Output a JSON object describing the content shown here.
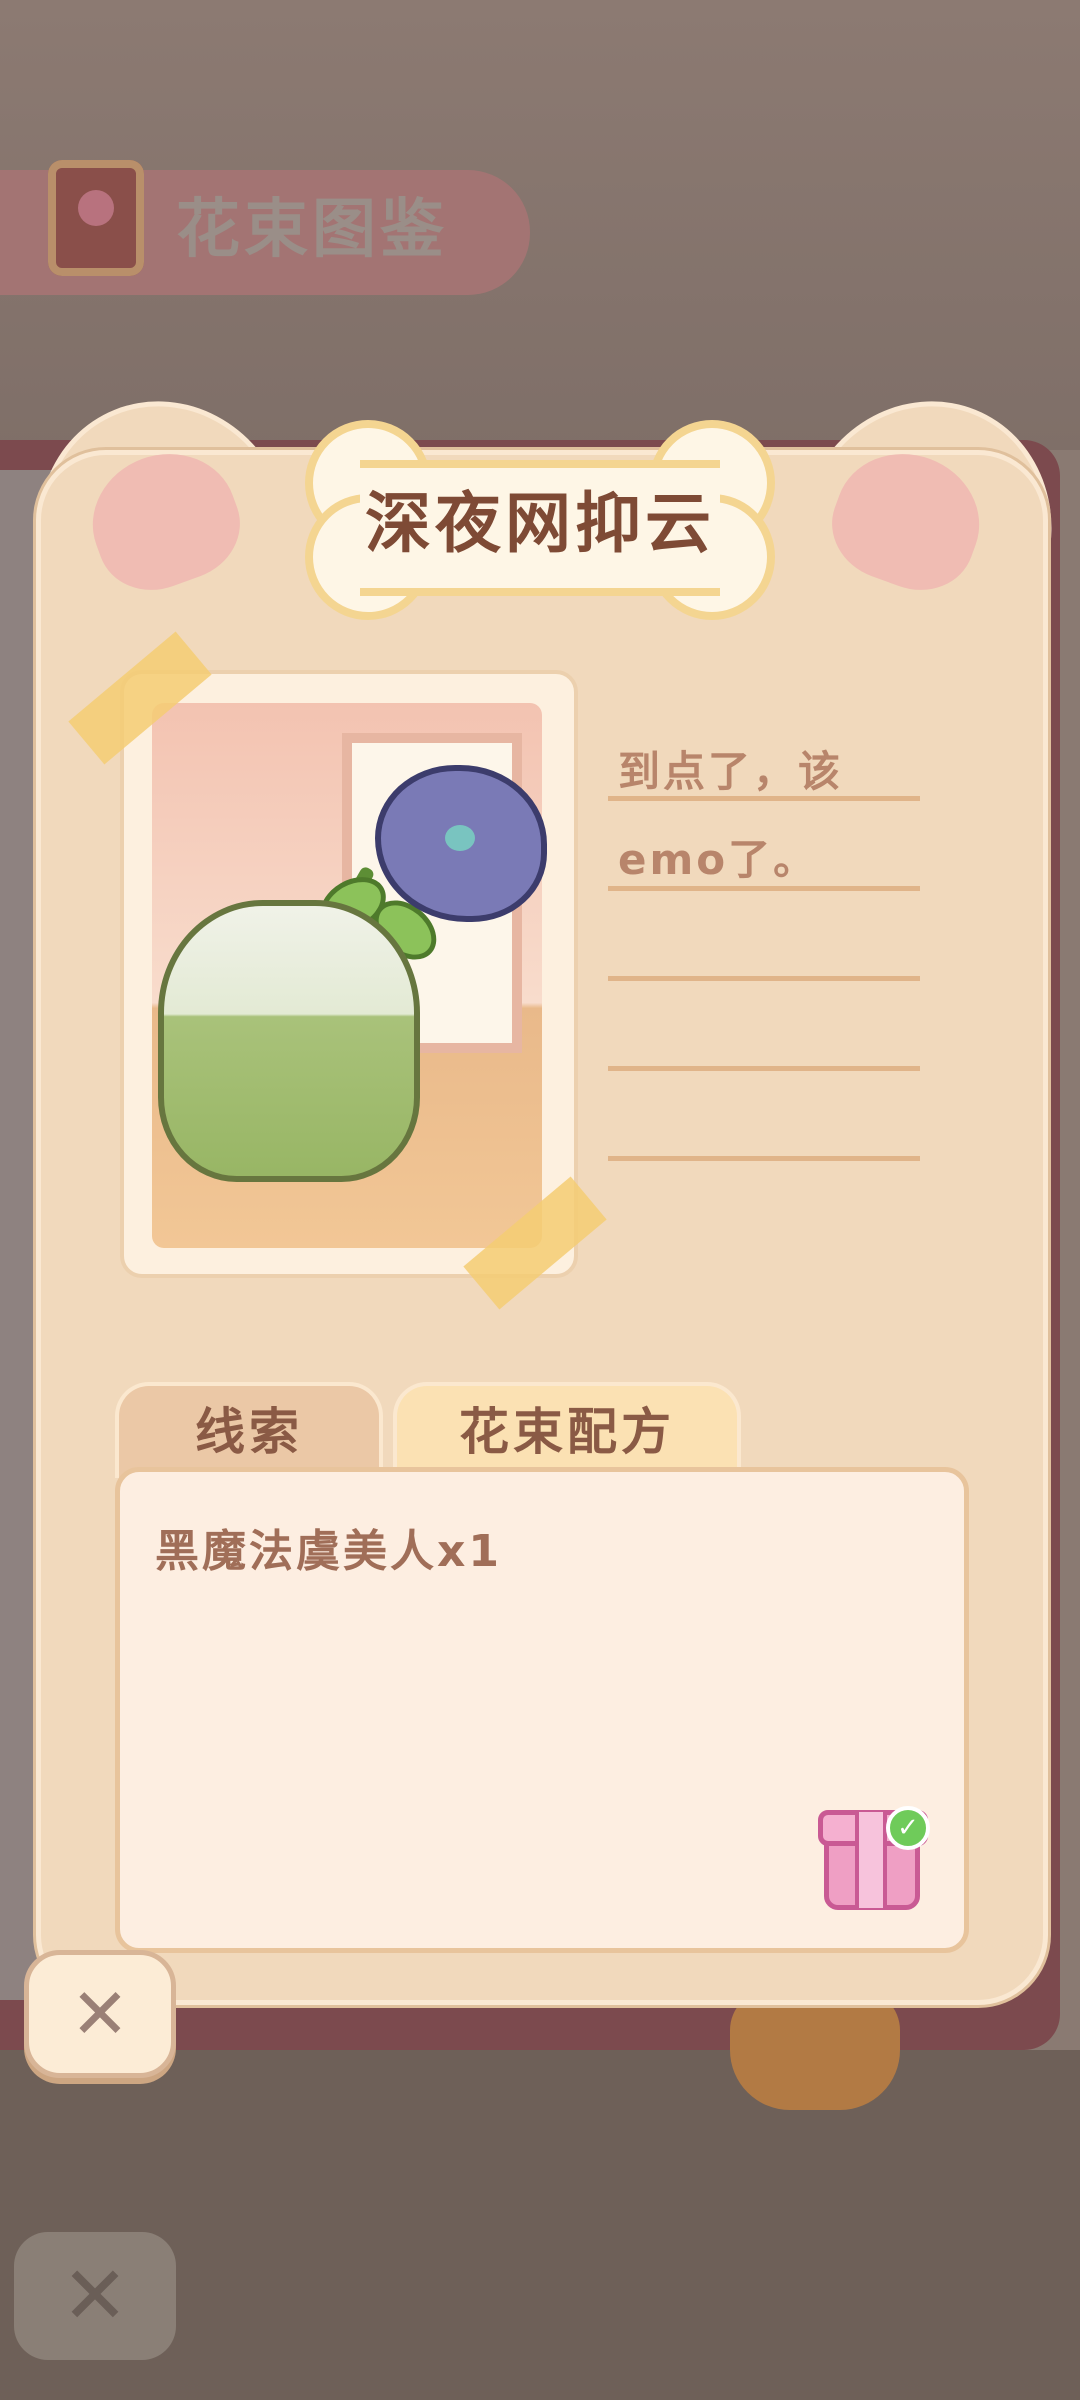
{
  "background": {
    "title": "花束图鉴",
    "close_label": "✕"
  },
  "card": {
    "flower_name": "深夜网抑云",
    "note_lines": [
      "到点了，该",
      "emo了。",
      "",
      "",
      ""
    ],
    "tabs": [
      {
        "label": "线索",
        "active": false
      },
      {
        "label": "花束配方",
        "active": true
      }
    ],
    "recipe": {
      "ingredient": "黑魔法虞美人x1",
      "reward_claimed": true
    },
    "close_label": "✕"
  },
  "colors": {
    "card_bg": "#f1d9bc",
    "title_text": "#7e4a35",
    "active_tab": "#fbe1b3",
    "panel_bg": "#fdeee1"
  },
  "icons": [
    "flower-book-icon",
    "gift-icon",
    "check-icon",
    "close-icon"
  ]
}
